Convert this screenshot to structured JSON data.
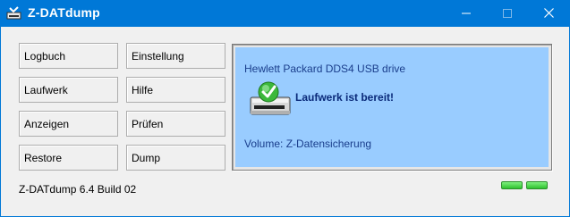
{
  "window": {
    "title": "Z-DATdump",
    "accent_color": "#0078d7",
    "icons": {
      "app": "tape-drive-app-icon",
      "minimize": "minimize-icon",
      "maximize": "maximize-icon",
      "close": "close-icon"
    }
  },
  "buttons": {
    "logbuch": "Logbuch",
    "einstellung": "Einstellung",
    "laufwerk": "Laufwerk",
    "hilfe": "Hilfe",
    "anzeigen": "Anzeigen",
    "pruefen": "Prüfen",
    "restore": "Restore",
    "dump": "Dump"
  },
  "status": {
    "drive_name": "Hewlett Packard DDS4 USB drive",
    "ready_text": "Laufwerk ist bereit!",
    "volume": "Volume: Z-Datensicherung",
    "panel_color": "#99ccff",
    "drive_icon": "tape-drive-ready-icon"
  },
  "footer": {
    "version": "Z-DATdump 6.4 Build 02",
    "led_color": "#4cdc4c"
  }
}
